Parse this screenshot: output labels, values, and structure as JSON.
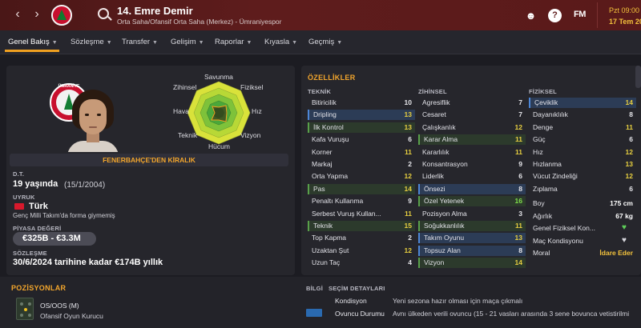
{
  "header": {
    "player_title": "14. Emre Demir",
    "role_line": "Orta Saha/Ofansif Orta Saha (Merkez) - Ümraniyespor",
    "date_line1": "Pzt 09:00",
    "date_line2": "17 Tem 20",
    "fm_label": "FM",
    "help_label": "?",
    "icons": [
      "back-arrow",
      "forward-arrow",
      "club-badge",
      "search-icon",
      "manager-icon",
      "help-icon",
      "fm-logo"
    ]
  },
  "tabs": [
    {
      "label": "Genel Bakış"
    },
    {
      "label": "Sözleşme"
    },
    {
      "label": "Transfer"
    },
    {
      "label": "Gelişim"
    },
    {
      "label": "Raporlar"
    },
    {
      "label": "Kıyasla"
    },
    {
      "label": "Geçmiş"
    }
  ],
  "crest": {
    "word": "ÜMRANİYE"
  },
  "radar": {
    "labels": {
      "top": "Savunma",
      "top_left": "Zihinsel",
      "top_right": "Fiziksel",
      "left": "Hava",
      "right": "Hız",
      "bottom_left": "Teknik",
      "bottom_right": "Vizyon",
      "bottom": "Hücum"
    }
  },
  "profile": {
    "loan_text": "FENERBAHÇE'DEN KİRALIK",
    "dob_label": "D.T.",
    "age": "19 yaşında",
    "dob": "(15/1/2004)",
    "nationality_label": "UYRUK",
    "nationality": "Türk",
    "caps_note": "Genç Milli Takım'da forma giymemiş",
    "value_label": "PİYASA DEĞERİ",
    "value": "€325B - €3.3M",
    "contract_label": "SÖZLEŞME",
    "contract": "30/6/2024 tarihine kadar €174B yıllık"
  },
  "attributes": {
    "section_title": "ÖZELLİKLER",
    "technical": {
      "title": "TEKNİK",
      "rows": [
        {
          "name": "Bitiricilik",
          "value": "10",
          "hl": ""
        },
        {
          "name": "Dripling",
          "value": "13",
          "hl": "blue"
        },
        {
          "name": "İlk Kontrol",
          "value": "13",
          "hl": "green"
        },
        {
          "name": "Kafa Vuruşu",
          "value": "6",
          "hl": ""
        },
        {
          "name": "Korner",
          "value": "11",
          "hl": ""
        },
        {
          "name": "Markaj",
          "value": "2",
          "hl": ""
        },
        {
          "name": "Orta Yapma",
          "value": "12",
          "hl": ""
        },
        {
          "name": "Pas",
          "value": "14",
          "hl": "green"
        },
        {
          "name": "Penaltı Kullanma",
          "value": "9",
          "hl": ""
        },
        {
          "name": "Serbest Vuruş Kullan...",
          "value": "11",
          "hl": ""
        },
        {
          "name": "Teknik",
          "value": "15",
          "hl": "green"
        },
        {
          "name": "Top Kapma",
          "value": "2",
          "hl": ""
        },
        {
          "name": "Uzaktan Şut",
          "value": "12",
          "hl": ""
        },
        {
          "name": "Uzun Taç",
          "value": "4",
          "hl": ""
        }
      ]
    },
    "mental": {
      "title": "ZİHİNSEL",
      "rows": [
        {
          "name": "Agresiflik",
          "value": "7",
          "hl": ""
        },
        {
          "name": "Cesaret",
          "value": "7",
          "hl": ""
        },
        {
          "name": "Çalışkanlık",
          "value": "12",
          "hl": ""
        },
        {
          "name": "Karar Alma",
          "value": "11",
          "hl": "green"
        },
        {
          "name": "Kararlılık",
          "value": "11",
          "hl": ""
        },
        {
          "name": "Konsantrasyon",
          "value": "9",
          "hl": ""
        },
        {
          "name": "Liderlik",
          "value": "6",
          "hl": ""
        },
        {
          "name": "Önsezi",
          "value": "8",
          "hl": "blue"
        },
        {
          "name": "Özel Yetenek",
          "value": "16",
          "hl": "green"
        },
        {
          "name": "Pozisyon Alma",
          "value": "3",
          "hl": ""
        },
        {
          "name": "Soğukkanlılık",
          "value": "11",
          "hl": "green"
        },
        {
          "name": "Takım Oyunu",
          "value": "13",
          "hl": "blue"
        },
        {
          "name": "Topsuz Alan",
          "value": "8",
          "hl": "blue"
        },
        {
          "name": "Vizyon",
          "value": "14",
          "hl": "green"
        }
      ]
    },
    "physical": {
      "title": "FİZİKSEL",
      "rows": [
        {
          "name": "Çeviklik",
          "value": "14",
          "hl": "blue"
        },
        {
          "name": "Dayanıklılık",
          "value": "8",
          "hl": ""
        },
        {
          "name": "Denge",
          "value": "11",
          "hl": ""
        },
        {
          "name": "Güç",
          "value": "6",
          "hl": ""
        },
        {
          "name": "Hız",
          "value": "12",
          "hl": ""
        },
        {
          "name": "Hızlanma",
          "value": "13",
          "hl": ""
        },
        {
          "name": "Vücut Zindeliği",
          "value": "12",
          "hl": ""
        },
        {
          "name": "Zıplama",
          "value": "6",
          "hl": ""
        }
      ]
    },
    "info": [
      {
        "name": "Boy",
        "value": "175 cm"
      },
      {
        "name": "Ağırlık",
        "value": "67 kg"
      },
      {
        "name": "Genel Fiziksel Kon...",
        "value": ""
      },
      {
        "name": "Maç Kondisyonu",
        "value": ""
      },
      {
        "name": "Moral",
        "value": "İdare Eder"
      }
    ]
  },
  "positions": {
    "title": "POZİSYONLAR",
    "main": "OS/OOS (M)",
    "role": "Ofansif Oyun Kurucu"
  },
  "details": {
    "tab_info": "BİLGİ",
    "tab_selection": "SEÇİM DETAYLARI",
    "rows": [
      {
        "label": "Kondisyon",
        "text": "Yeni sezona hazır olması için maça çıkmalı"
      },
      {
        "label": "Ovuncu Durumu",
        "text": "Avnı ülkeden verili ovuncu (15 - 21 vasları arasında 3 sene bovunca vetistirilmi"
      }
    ]
  },
  "colors": {
    "accent_orange": "#f3a62c",
    "good_green": "#8fd14f",
    "mid_yellow": "#e8c84a",
    "low_white": "#e6e6ea",
    "highlight_blue": "#4d86d6",
    "header_red": "#5e1c1c"
  }
}
